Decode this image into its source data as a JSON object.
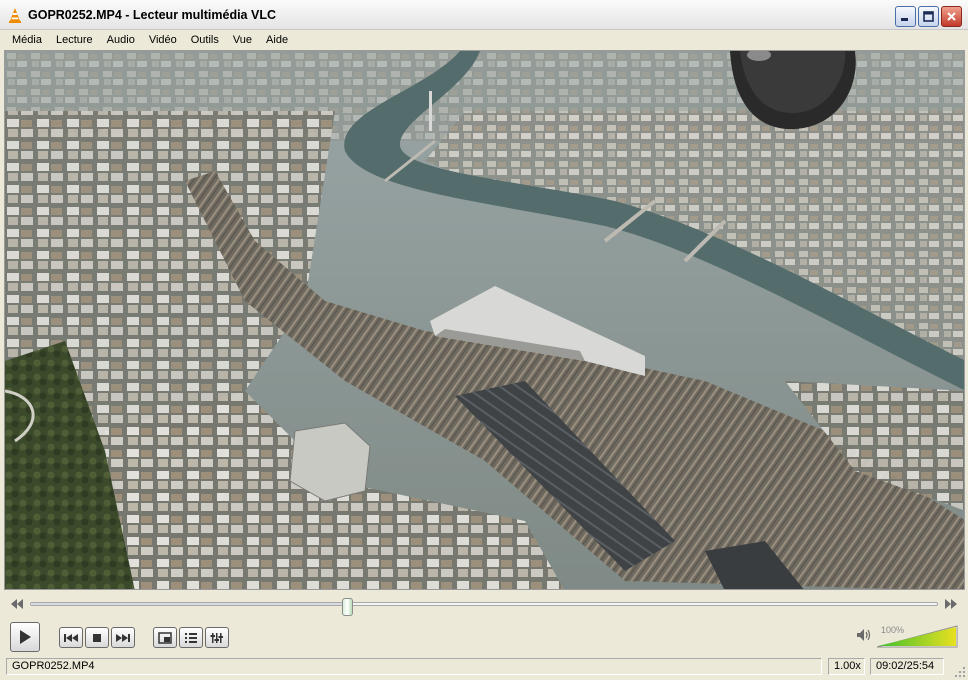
{
  "window": {
    "title": "GOPR0252.MP4 - Lecteur multimédia VLC",
    "icon": "vlc-cone-icon",
    "controls": [
      "minimize-icon",
      "maximize-icon",
      "close-icon"
    ]
  },
  "menu": {
    "items": [
      "Média",
      "Lecture",
      "Audio",
      "Vidéo",
      "Outils",
      "Vue",
      "Aide"
    ]
  },
  "video": {
    "content": "aerial-city-view-image"
  },
  "seek": {
    "position_fraction": 0.35,
    "icons": [
      "slower-icon",
      "faster-icon"
    ]
  },
  "controls": {
    "buttons": [
      "play-icon",
      "previous-icon",
      "stop-icon",
      "next-icon",
      "fullscreen-icon",
      "playlist-icon",
      "extended-settings-icon"
    ]
  },
  "volume": {
    "label": "100%",
    "level_fraction": 1.0,
    "icon": "speaker-icon"
  },
  "status": {
    "filename": "GOPR0252.MP4",
    "speed": "1.00x",
    "time": "09:02/25:54"
  },
  "colors": {
    "vlc_orange": "#f08a00",
    "close_red": "#c23a2a",
    "volume_green": "#3fbf2f",
    "volume_yellow": "#e8e020"
  }
}
